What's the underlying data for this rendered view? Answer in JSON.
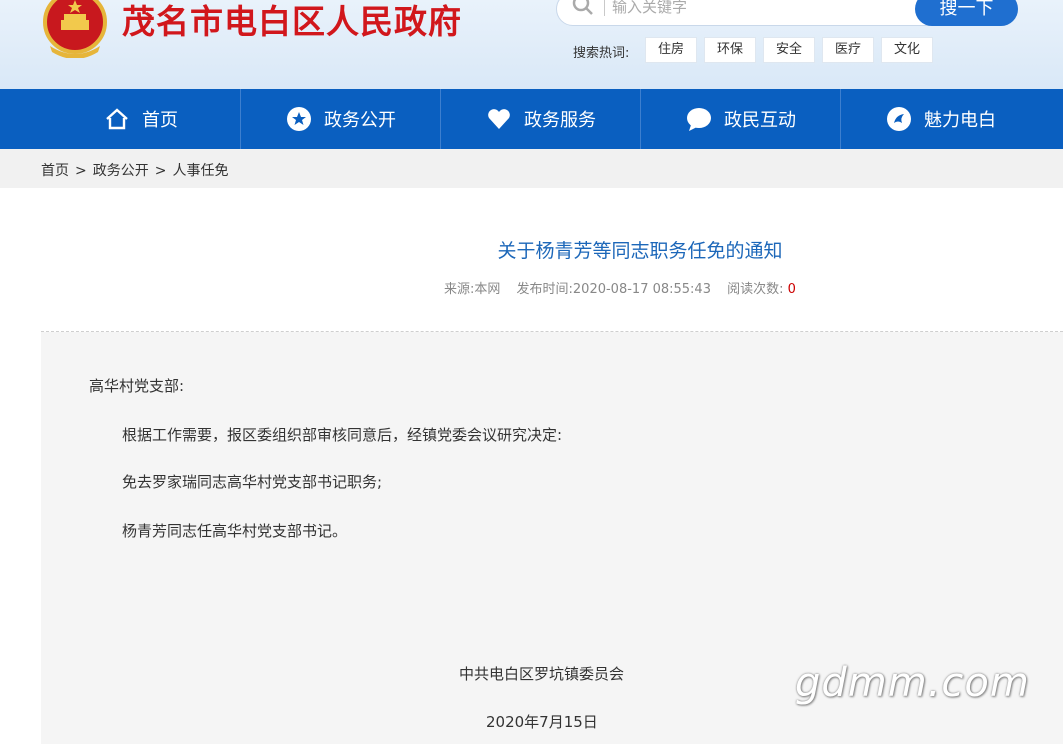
{
  "header": {
    "site_title": "茂名市电白区人民政府",
    "search": {
      "placeholder": "输入关键字",
      "button_label": "搜一下"
    },
    "hot_label": "搜索热词:",
    "hot_tags": [
      "住房",
      "环保",
      "安全",
      "医疗",
      "文化"
    ]
  },
  "nav": {
    "items": [
      {
        "label": "首页",
        "icon": "home-icon"
      },
      {
        "label": "政务公开",
        "icon": "star-icon"
      },
      {
        "label": "政务服务",
        "icon": "heart-icon"
      },
      {
        "label": "政民互动",
        "icon": "chat-bubble-icon"
      },
      {
        "label": "魅力电白",
        "icon": "compass-icon"
      }
    ]
  },
  "breadcrumb": [
    "首页",
    "政务公开",
    "人事任免"
  ],
  "breadcrumb_sep": ">",
  "article": {
    "title": "关于杨青芳等同志职务任免的通知",
    "source": "来源:本网",
    "publish_time": "发布时间:2020-08-17 08:55:43",
    "views_label": "阅读次数:",
    "views": "0",
    "salutation": "高华村党支部:",
    "paragraphs": [
      "根据工作需要，报区委组织部审核同意后，经镇党委会议研究决定:",
      "免去罗家瑞同志高华村党支部书记职务;",
      "杨青芳同志任高华村党支部书记。"
    ],
    "signature": "中共电白区罗坑镇委员会",
    "date": "2020年7月15日"
  },
  "watermark": "gdmm.com",
  "colors": {
    "brand_red": "#d1171c",
    "nav_blue": "#0a5fc0",
    "title_blue": "#1c67b9",
    "count_red": "#cc0000"
  }
}
